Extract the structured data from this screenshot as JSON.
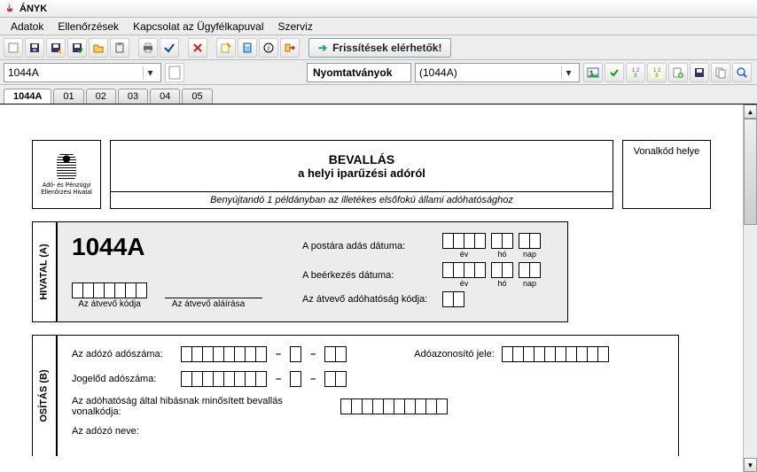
{
  "window": {
    "title": "ÁNYK"
  },
  "menu": {
    "items": [
      "Adatok",
      "Ellenőrzések",
      "Kapcsolat az Ügyfélkapuval",
      "Szerviz"
    ]
  },
  "toolbar": {
    "update_label": "Frissítések elérhetők!"
  },
  "selector": {
    "form_code": "1044A",
    "print_label": "Nyomtatványok",
    "print_value": "(1044A)"
  },
  "tabs": [
    "1044A",
    "01",
    "02",
    "03",
    "04",
    "05"
  ],
  "form": {
    "logo_line1": "Adó- és Pénzügyi",
    "logo_line2": "Ellenőrzési Hivatal",
    "title_line1": "BEVALLÁS",
    "title_line2": "a helyi iparűzési adóról",
    "subtitle": "Benyújtandó 1 példányban az illetékes elsőfokú állami adóhatósághoz",
    "barcode_label": "Vonalkód helye",
    "code": "1044A",
    "section_a_label": "HIVATAL (A)",
    "recv_code_label": "Az átvevő kódja",
    "recv_sign_label": "Az átvevő aláírása",
    "post_date_label": "A postára adás dátuma:",
    "recv_date_label": "A beérkezés dátuma:",
    "auth_code_label": "Az átvevő adóhatóság kódja:",
    "year_label": "év",
    "month_label": "hó",
    "day_label": "nap",
    "section_b_label": "OSÍTÁS (B)",
    "taxno_label": "Az adózó adószáma:",
    "taxid_label": "Adóazonosító jele:",
    "pred_label": "Jogelőd adószáma:",
    "faulty_label": "Az adóhatóság által hibásnak minősített bevallás vonalkódja:",
    "name_label": "Az adózó neve:"
  }
}
